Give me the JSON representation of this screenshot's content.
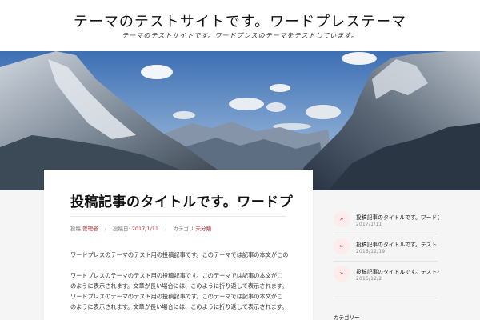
{
  "site": {
    "title": "テーマのテストサイトです。ワードプレステーマ",
    "description": "テーマのテストサイトです。ワードプレスのテーマをテストしています。"
  },
  "hero": {
    "image_alt": "mountain-landscape"
  },
  "post": {
    "title": "投稿記事のタイトルです。ワードプレスのテーマ",
    "meta": {
      "by_label": "投稿",
      "author": "管理者",
      "date_label": "投稿日",
      "date": "2017/1/11",
      "category_label": "カテゴリ",
      "category": "未分類"
    },
    "paragraph1": "ワードプレスのテーマのテスト用の投稿記事です。このテーマでは記事の本文がこのように表示されます。",
    "paragraph2": "ワードプレスのテーマのテスト用の投稿記事です。このテーマでは記事の本文がこのように表示されます。文章が長い場合には、このように折り返して表示されます。ワードプレスのテーマのテスト用の投稿記事です。このテーマでは記事の本文がこのように表示されます。文章が長い場合には、このように折り返して表示されます。ワードプレスのテーマのテスト用の投稿記事です。"
  },
  "sidebar": {
    "recent_posts": [
      {
        "title": "投稿記事のタイトルです。ワードプレスのテーマ",
        "date": "2017/1/11"
      },
      {
        "title": "投稿記事のタイトルです。テスト",
        "date": "2016/12/19"
      },
      {
        "title": "投稿記事のタイトルです。テスト投稿",
        "date": "2016/12/2"
      }
    ],
    "bottom_label": "カテゴリー"
  },
  "colors": {
    "accent": "#b32a2a",
    "background": "#f5f5f5"
  }
}
